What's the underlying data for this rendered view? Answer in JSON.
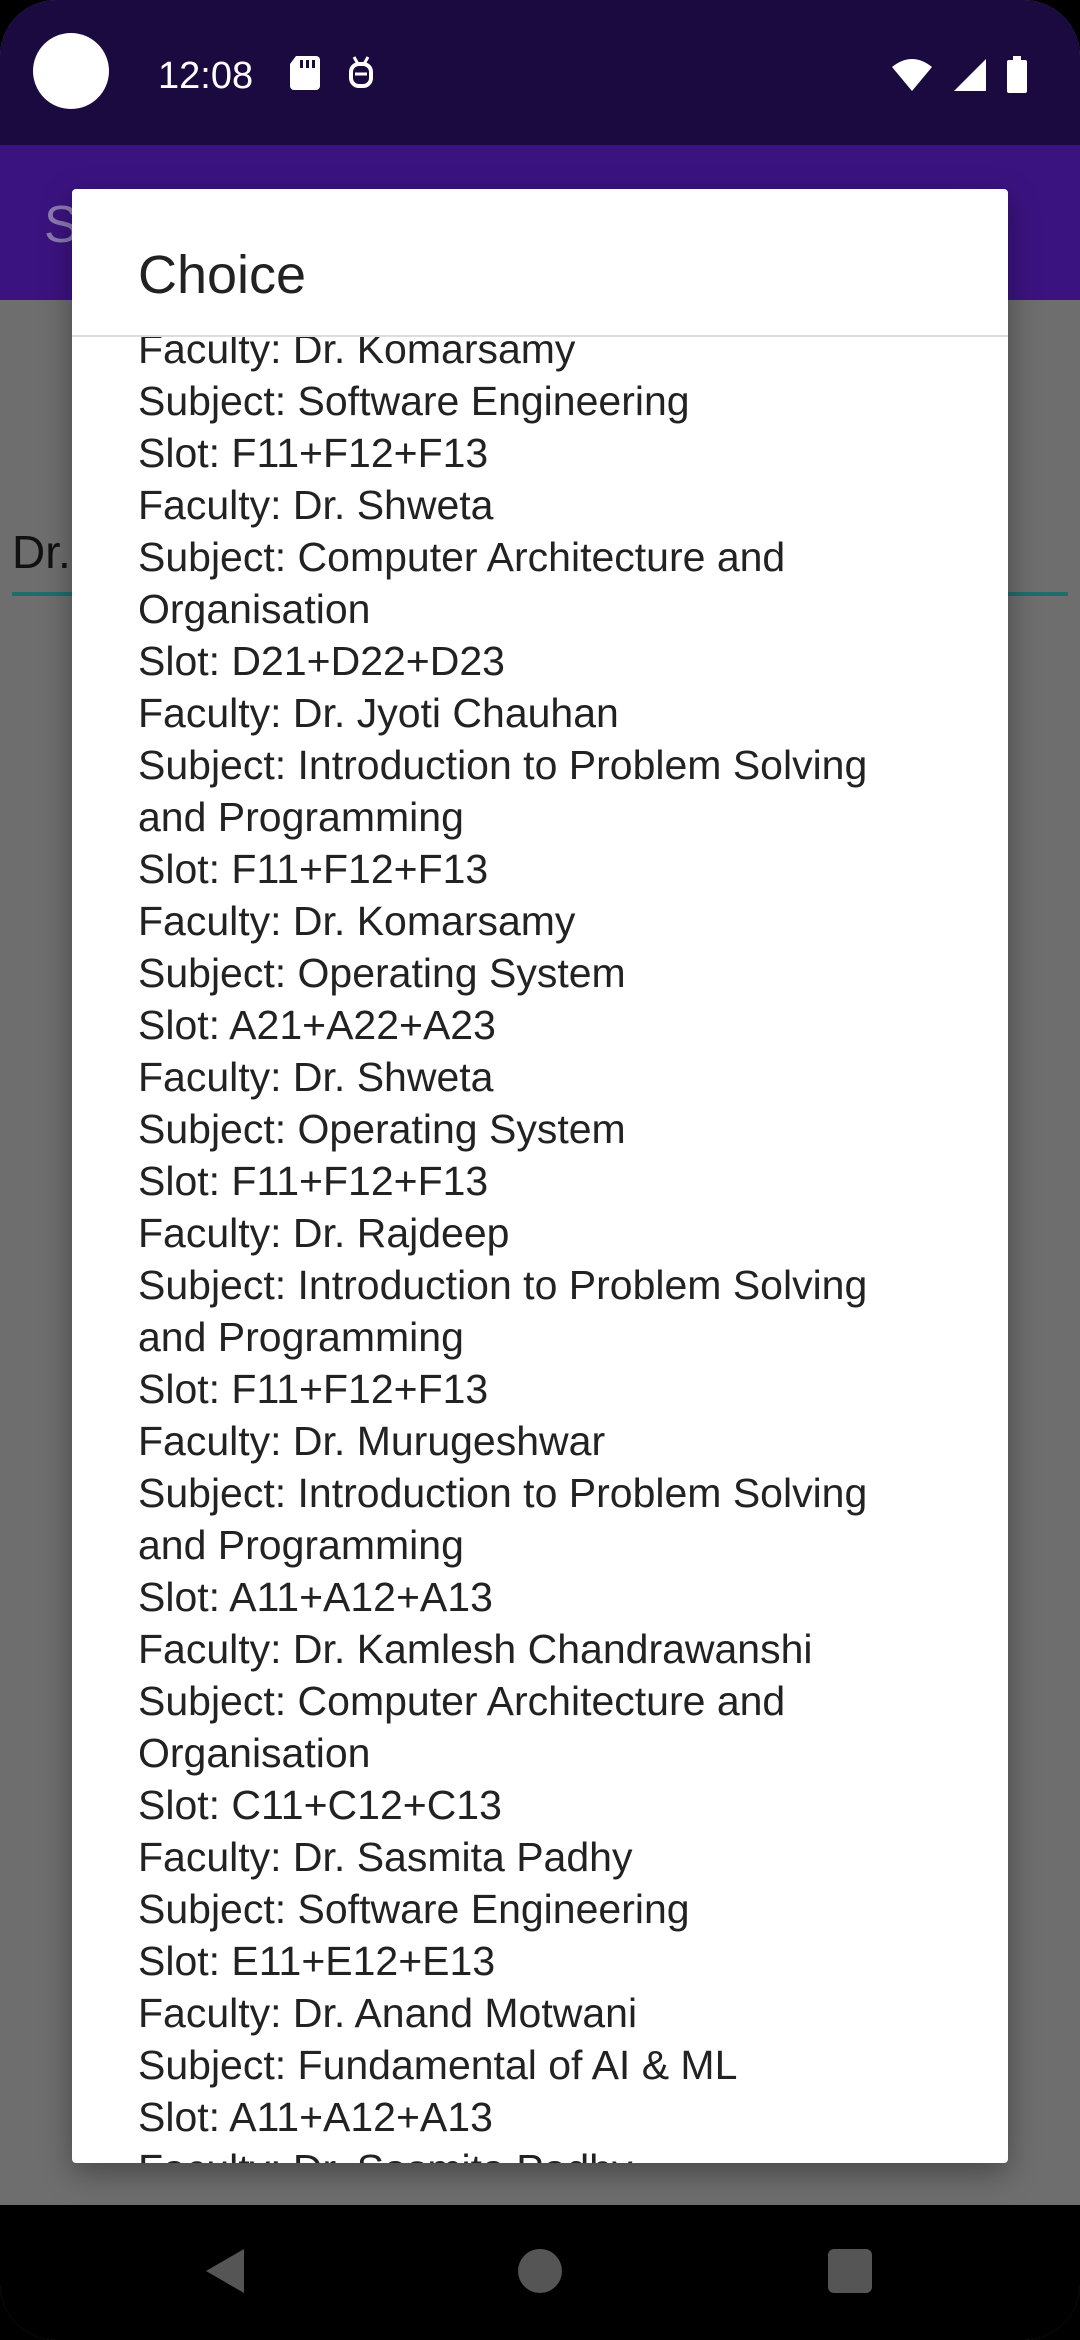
{
  "status_bar": {
    "time": "12:08",
    "icons": [
      "sd-card-icon",
      "debug-icon",
      "wifi-icon",
      "signal-icon",
      "battery-icon"
    ]
  },
  "app_bar": {
    "title_visible_fragment": "S"
  },
  "background": {
    "field_text_fragment": "Dr."
  },
  "dialog": {
    "title": "Choice",
    "lines": [
      "Faculty: Dr. Komarsamy",
      "Subject: Software Engineering",
      "Slot: F11+F12+F13",
      "Faculty: Dr. Shweta",
      "Subject: Computer Architecture and",
      "Organisation",
      "Slot: D21+D22+D23",
      "Faculty: Dr. Jyoti Chauhan",
      "Subject: Introduction to Problem Solving",
      "and Programming",
      "Slot: F11+F12+F13",
      "Faculty: Dr. Komarsamy",
      "Subject: Operating System",
      "Slot: A21+A22+A23",
      "Faculty: Dr. Shweta",
      "Subject: Operating System",
      "Slot: F11+F12+F13",
      "Faculty: Dr. Rajdeep",
      "Subject: Introduction to Problem Solving",
      "and Programming",
      "Slot: F11+F12+F13",
      "Faculty: Dr. Murugeshwar",
      "Subject: Introduction to Problem Solving",
      "and Programming",
      "Slot: A11+A12+A13",
      "Faculty: Dr. Kamlesh Chandrawanshi",
      "Subject: Computer Architecture and",
      "Organisation",
      "Slot: C11+C12+C13",
      "Faculty: Dr. Sasmita Padhy",
      "Subject: Software Engineering",
      "Slot: E11+E12+E13",
      "Faculty: Dr. Anand Motwani",
      "Subject: Fundamental of AI & ML",
      "Slot: A11+A12+A13",
      "Faculty: Dr. Sasmita Padhy"
    ]
  },
  "nav_bar": {
    "icons": [
      "back-icon",
      "home-icon",
      "recents-icon"
    ]
  }
}
